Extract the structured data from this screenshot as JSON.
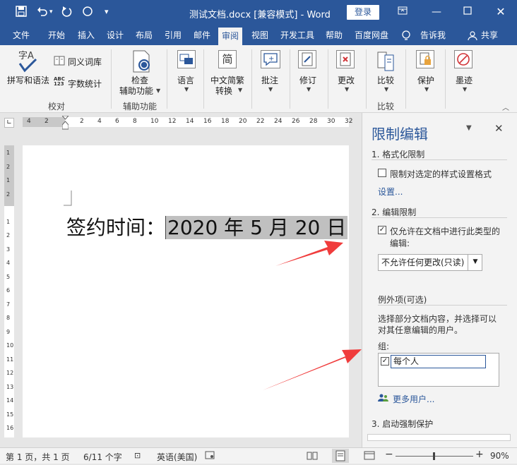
{
  "titlebar": {
    "title": "测试文档.docx [兼容模式] - Word",
    "login": "登录",
    "save_icon": "save-icon",
    "undo_icon": "undo-icon",
    "redo_icon": "redo-icon",
    "circle_icon": "circle-icon",
    "customize_icon": "customize-qat-icon",
    "window_controls": [
      "ribbon-display-icon",
      "minimize-icon",
      "maximize-icon",
      "close-icon"
    ]
  },
  "tabs": [
    "文件",
    "开始",
    "插入",
    "设计",
    "布局",
    "引用",
    "邮件",
    "审阅",
    "视图",
    "开发工具",
    "帮助",
    "百度网盘",
    "告诉我",
    "共享"
  ],
  "active_tab": "审阅",
  "ribbon": {
    "proofing": {
      "group": "校对",
      "spelling": "拼写和语法",
      "thesaurus": "同义词库",
      "wordcount": "字数统计"
    },
    "accessibility": {
      "group": "辅助功能",
      "check_line1": "检查",
      "check_line2": "辅助功能"
    },
    "language": "语言",
    "chinese_line1": "中文简繁",
    "chinese_line2": "转换",
    "comments": "批注",
    "tracking": "修订",
    "changes": "更改",
    "compare": {
      "button": "比较",
      "group": "比较"
    },
    "protect": "保护",
    "ink": "墨迹"
  },
  "ruler": {
    "ticks": [
      "4",
      "2",
      "",
      "2",
      "4",
      "6",
      "8",
      "10",
      "12",
      "14",
      "16",
      "18",
      "20",
      "22",
      "24",
      "26",
      "28",
      "30",
      "32"
    ],
    "vticks": [
      "1",
      "2",
      "1",
      "2",
      "",
      "1",
      "2",
      "3",
      "4",
      "5",
      "6",
      "7",
      "8",
      "9",
      "10",
      "11",
      "12",
      "13",
      "14",
      "15",
      "16"
    ]
  },
  "document": {
    "label": "签约时间：",
    "value": "2020 年 5 月 20 日"
  },
  "pane": {
    "title": "限制编辑",
    "sec1": "1. 格式化限制",
    "sec1_check": "限制对选定的样式设置格式",
    "settings_link": "设置...",
    "sec2": "2. 编辑限制",
    "sec2_check_line1": "仅允许在文档中进行此类型的",
    "sec2_check_line2": "编辑:",
    "edit_type": "不允许任何更改(只读)",
    "exceptions": "例外项(可选)",
    "exceptions_desc1": "选择部分文档内容，并选择可以",
    "exceptions_desc2": "对其任意编辑的用户。",
    "groups_label": "组:",
    "group_everyone": "每个人",
    "more_users": "更多用户...",
    "sec3": "3. 启动强制保护"
  },
  "statusbar": {
    "page": "第 1 页，共 1 页",
    "words": "6/11 个字",
    "language": "英语(美国)",
    "zoom": "90%"
  },
  "colors": {
    "accent": "#2b579a",
    "arrow": "#f03c3c",
    "selection": "#c0c0c0"
  }
}
